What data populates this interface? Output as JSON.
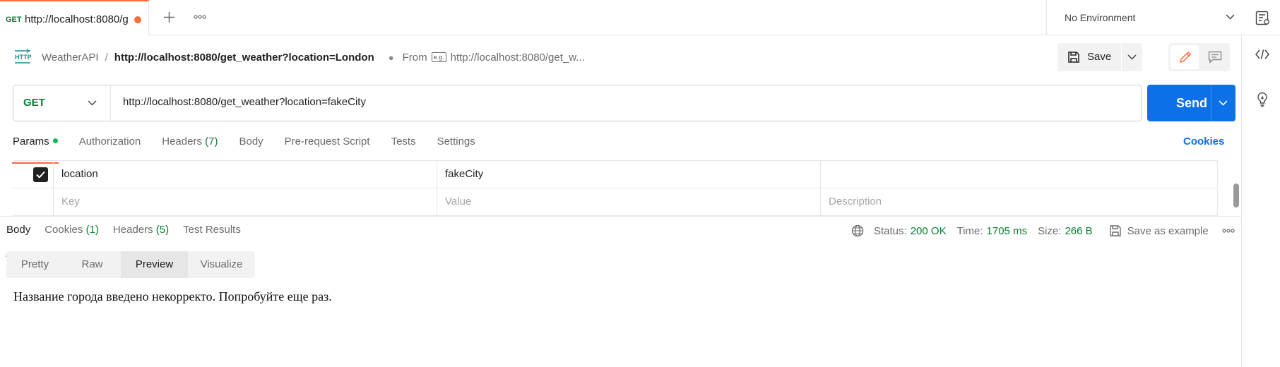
{
  "tabbar": {
    "active_tab": {
      "method": "GET",
      "url": "http://localhost:8080/g"
    },
    "environment": "No Environment"
  },
  "header": {
    "collection": "WeatherAPI",
    "separator": "/",
    "request_name": "http://localhost:8080/get_weather?location=London",
    "from_label": "From",
    "example_badge": "e.g.",
    "from_url": "http://localhost:8080/get_w...",
    "save_label": "Save"
  },
  "request": {
    "method": "GET",
    "url": "http://localhost:8080/get_weather?location=fakeCity",
    "send_label": "Send"
  },
  "request_tabs": [
    {
      "label": "Params",
      "count": ""
    },
    {
      "label": "Authorization",
      "count": ""
    },
    {
      "label": "Headers",
      "count": "(7)"
    },
    {
      "label": "Body",
      "count": ""
    },
    {
      "label": "Pre-request Script",
      "count": ""
    },
    {
      "label": "Tests",
      "count": ""
    },
    {
      "label": "Settings",
      "count": ""
    }
  ],
  "cookies_link": "Cookies",
  "params": {
    "rows": [
      {
        "checked": true,
        "key": "location",
        "value": "fakeCity",
        "description": ""
      }
    ],
    "placeholders": {
      "key": "Key",
      "value": "Value",
      "description": "Description"
    }
  },
  "response": {
    "tabs": [
      {
        "label": "Body",
        "count": ""
      },
      {
        "label": "Cookies",
        "count": "(1)"
      },
      {
        "label": "Headers",
        "count": "(5)"
      },
      {
        "label": "Test Results",
        "count": ""
      }
    ],
    "status_label": "Status:",
    "status_value": "200 OK",
    "time_label": "Time:",
    "time_value": "1705 ms",
    "size_label": "Size:",
    "size_value": "266 B",
    "save_example_label": "Save as example",
    "view_modes": [
      "Pretty",
      "Raw",
      "Preview",
      "Visualize"
    ],
    "body_text": "Название города введено некорректо. Попробуйте еще раз."
  },
  "colors": {
    "accent": "#ff6c37",
    "send_blue": "#0c71e8",
    "method_green": "#0a7d32",
    "status_green": "#0a7d32"
  },
  "icons": [
    "plus-icon",
    "more-icon",
    "chevron-down-icon",
    "environment-settings-icon",
    "http-icon",
    "save-icon",
    "edit-icon",
    "comment-icon",
    "code-icon",
    "lightbulb-icon",
    "check-icon",
    "globe-icon",
    "more-horizontal-icon"
  ]
}
